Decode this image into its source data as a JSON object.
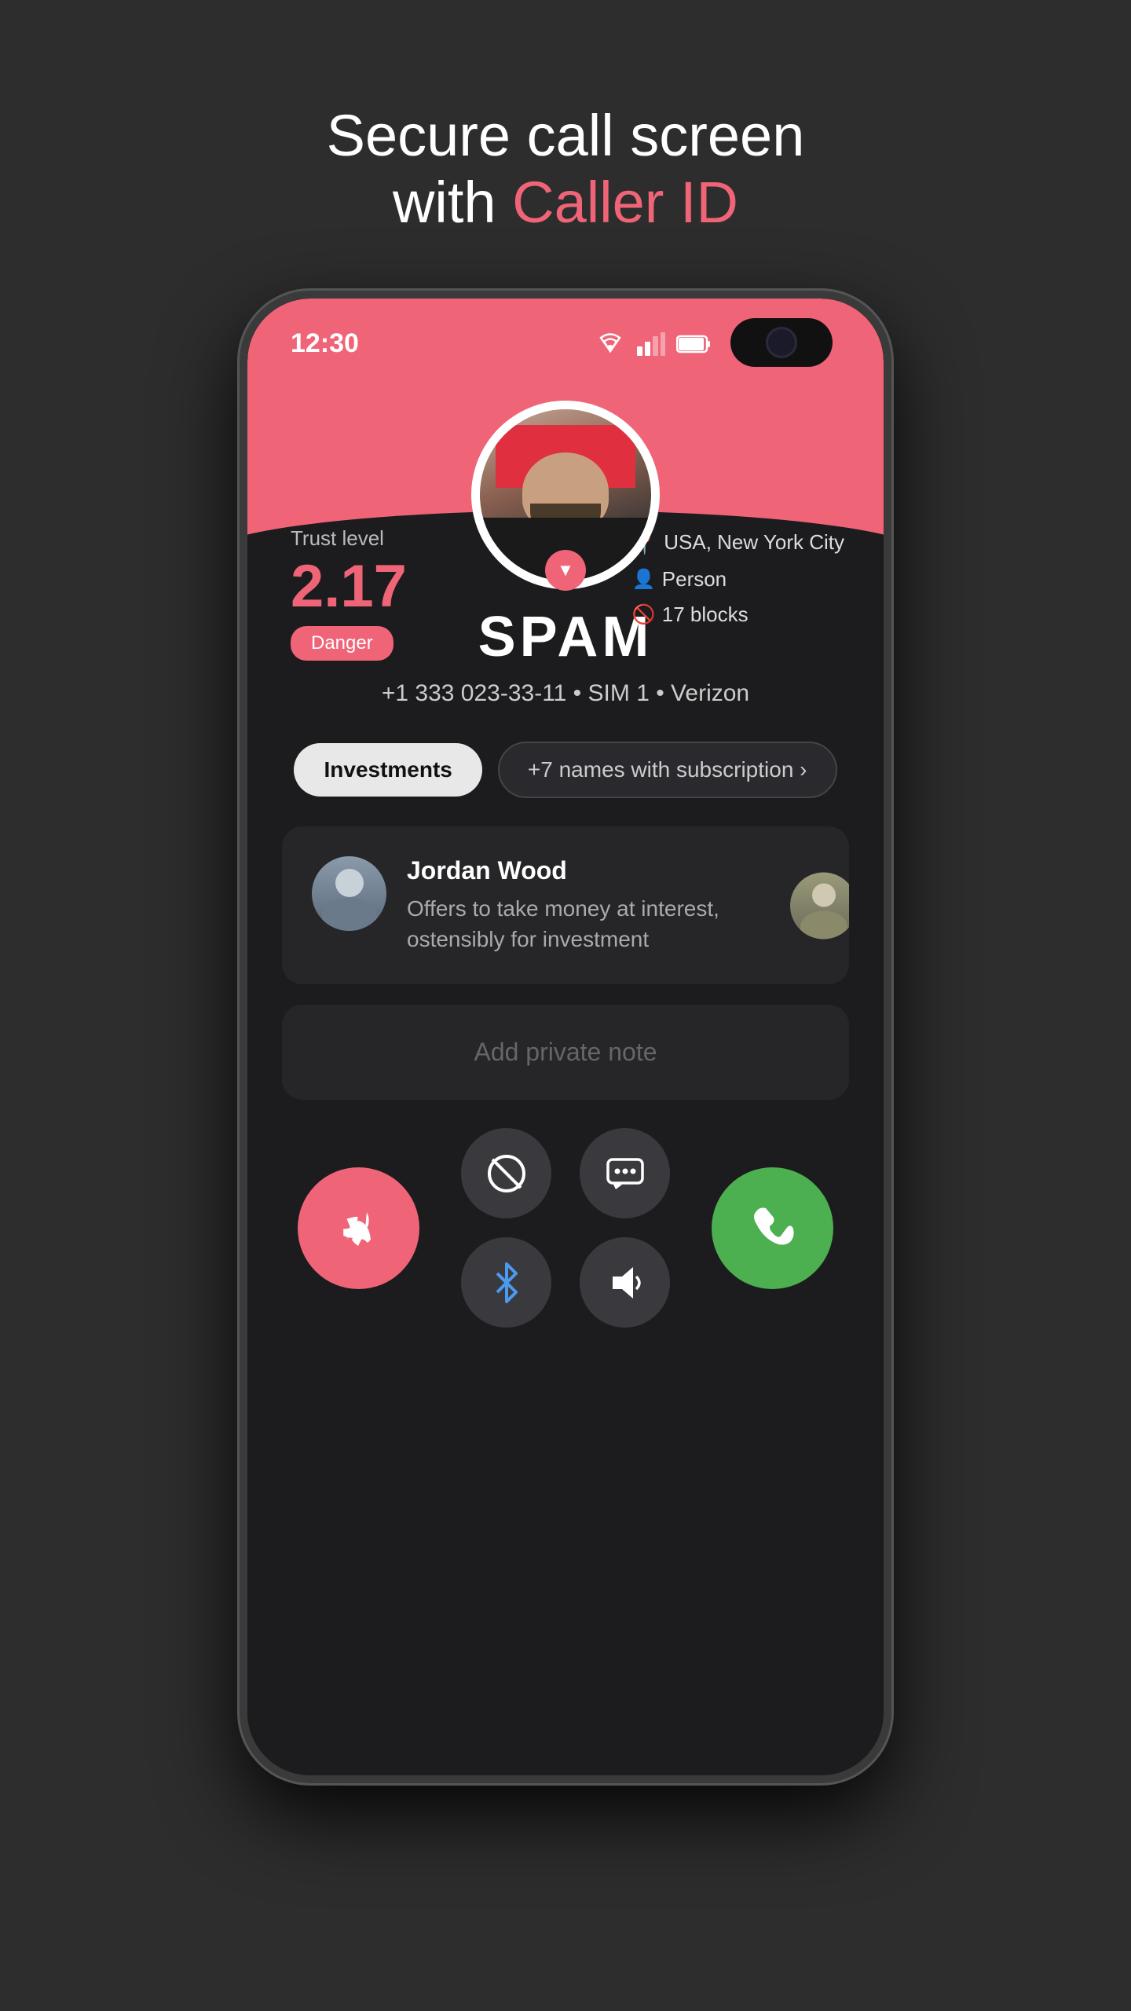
{
  "header": {
    "line1": "Secure call screen",
    "line2_prefix": "with ",
    "line2_highlight": "Caller ID"
  },
  "statusBar": {
    "time": "12:30"
  },
  "callScreen": {
    "trustLabel": "Trust level",
    "trustValue": "2.17",
    "dangerBadge": "Danger",
    "location": "USA, New York City",
    "category": "Person",
    "blocks": "17 blocks",
    "callerName": "SPAM",
    "callerNumber": "+1 333 023-33-11 • SIM 1 • Verizon",
    "tag1": "Investments",
    "tag2": "+7 names with subscription ›",
    "reviewerName": "Jordan Wood",
    "reviewerText": "Offers to take money at interest, ostensibly for investment",
    "privateNote": "Add private note"
  }
}
